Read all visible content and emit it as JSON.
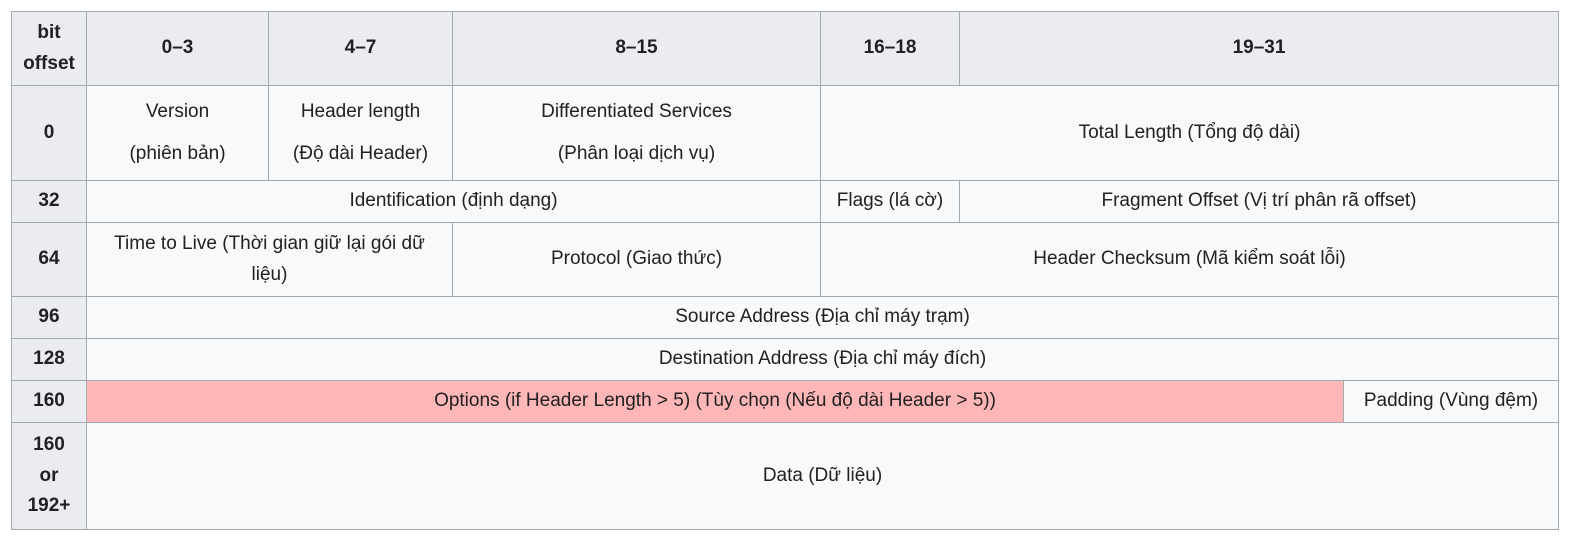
{
  "header": {
    "bit_offset": "bit offset",
    "bit_offset_line1": "bit",
    "bit_offset_line2": "offset",
    "cols": [
      "0–3",
      "4–7",
      "8–15",
      "16–18",
      "19–31"
    ]
  },
  "rows": {
    "r0": {
      "offset": "0",
      "version_line1": "Version",
      "version_line2": "(phiên bản)",
      "header_length_line1": "Header length",
      "header_length_line2": "(Độ dài Header)",
      "diff_services_line1": "Differentiated Services",
      "diff_services_line2": "(Phân loại dịch vụ)",
      "total_length": "Total Length (Tổng độ dài)"
    },
    "r32": {
      "offset": "32",
      "identification": "Identification (định dạng)",
      "flags": "Flags (lá cờ)",
      "fragment_offset": "Fragment Offset (Vị trí phân rã offset)"
    },
    "r64": {
      "offset": "64",
      "ttl": "Time to Live (Thời gian giữ lại gói dữ liệu)",
      "protocol": "Protocol (Giao thức)",
      "checksum": "Header Checksum (Mã kiểm soát lỗi)"
    },
    "r96": {
      "offset": "96",
      "source": "Source Address (Địa chỉ máy trạm)"
    },
    "r128": {
      "offset": "128",
      "destination": "Destination Address (Địa chỉ máy đích)"
    },
    "r160": {
      "offset": "160",
      "options": "Options (if Header Length > 5) (Tùy chọn (Nếu độ dài Header > 5))",
      "padding": "Padding (Vùng đệm)"
    },
    "rdata": {
      "offset_line1": "160",
      "offset_line2": "or",
      "offset_line3": "192+",
      "data": "Data (Dữ liệu)"
    }
  },
  "colors": {
    "header_bg": "#eaecf0",
    "cell_bg": "#f8f9fa",
    "border": "#a2a9b1",
    "options_bg": "#ffb6b6"
  }
}
